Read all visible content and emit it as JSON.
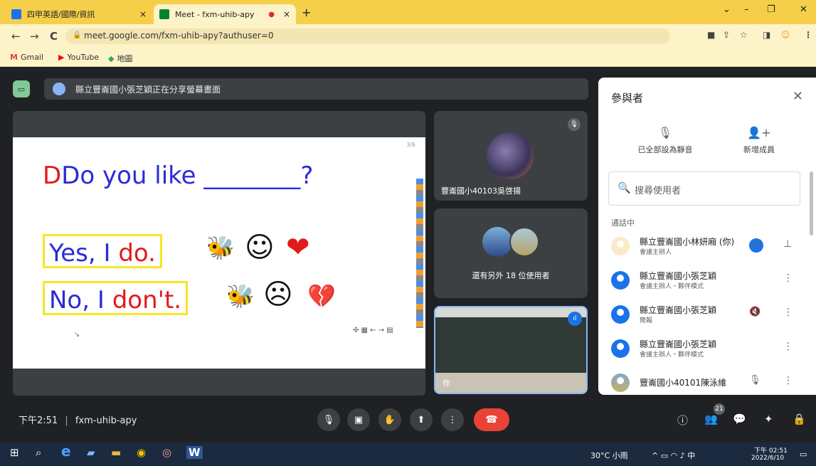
{
  "browser": {
    "tabs": [
      {
        "title": "四甲英語/國際/資訊",
        "favicon_color": "#1a73e8",
        "active": false
      },
      {
        "title": "Meet - fxm-uhib-apy",
        "favicon_color": "#00832d",
        "active": true
      }
    ],
    "close_glyph": "×",
    "record_glyph": "●",
    "newtab_glyph": "+",
    "window_controls": {
      "minimize": "–",
      "restore": "❐",
      "close": "✕",
      "dropdown": "⌄"
    },
    "nav": {
      "back": "←",
      "forward": "→",
      "reload": "C"
    },
    "url": "meet.google.com/fxm-uhib-apy?authuser=0",
    "lock_glyph": "🔒",
    "toolbar_icons": {
      "camera": "■",
      "share": "⇪",
      "star": "☆",
      "panel": "◨",
      "profile": "☺",
      "menu": "⋮"
    },
    "bookmarks": [
      {
        "label": "Gmail",
        "icon": "M",
        "icon_color": "#ea4335"
      },
      {
        "label": "YouTube",
        "icon": "▶",
        "icon_color": "#ff0000"
      },
      {
        "label": "地圖",
        "icon": "◆",
        "icon_color": "#34a853"
      }
    ]
  },
  "meet": {
    "share_icon": "▭",
    "share_banner": "縣立豐崙國小張芝穎正在分享螢幕畫面",
    "slide": {
      "question_prefix": "Do you like ",
      "question_blank": "________?",
      "yes_prefix": "Yes, I ",
      "yes_red": "do.",
      "no_prefix": "No, I ",
      "no_red": "don't.",
      "page_indicator": "3/6",
      "yes_emojis": "🐝 ☺ ❤",
      "no_emojis": "🐝 ☹ 💔",
      "yes_face": "☺",
      "no_face": "☹",
      "heart": "❤",
      "broken_heart": "💔",
      "bee": "🐝",
      "nav_widget": "✣ ▦ ← → ▤",
      "cursor": "↘"
    },
    "tiles": [
      {
        "name": "豐崙國小40103吳啓揚",
        "muted_icon": "🎙"
      },
      {
        "name": "還有另外 18 位使用者"
      },
      {
        "name": "你"
      }
    ]
  },
  "panel": {
    "title": "參與者",
    "close": "✕",
    "actions": [
      {
        "label": "已全部設為靜音",
        "icon": "🎙"
      },
      {
        "label": "新增成員",
        "icon": "👤+"
      }
    ],
    "search_icon": "🔍",
    "search_placeholder": "搜尋使用者",
    "section_label": "通話中",
    "participants": [
      {
        "name": "縣立豐崙國小林妍廂 (你)",
        "role": "會議主辦人",
        "icon1": "●",
        "icon2": "⊥"
      },
      {
        "name": "縣立豐崙國小張芝穎",
        "role": "會議主辦人・夥伴模式",
        "icon1": "",
        "icon2": "⋮"
      },
      {
        "name": "縣立豐崙國小張芝穎",
        "role": "簡報",
        "icon1": "🔇",
        "icon2": "⋮"
      },
      {
        "name": "縣立豐崙國小張芝穎",
        "role": "會議主辦人・夥伴模式",
        "icon1": "",
        "icon2": "⋮"
      },
      {
        "name": "豐崙國小40101陳泳維",
        "role": "",
        "icon1": "🎙",
        "icon2": "⋮"
      }
    ]
  },
  "bottom": {
    "time": "下午2:51",
    "separator": "|",
    "meeting_code": "fxm-uhib-apy",
    "controls": {
      "mic": "🎙",
      "camera": "▣",
      "hand": "✋",
      "present": "⬆",
      "more": "⋮",
      "leave": "☎"
    },
    "right_icons": {
      "info": "ⓘ",
      "people": "👥",
      "chat": "💬",
      "activities": "✦",
      "lock": "🔒"
    },
    "people_count": "21"
  },
  "taskbar": {
    "icons": {
      "start": "⊞",
      "search": "⌕",
      "ie": "e",
      "folder1": "▰",
      "folder2": "▬",
      "chrome": "◉",
      "chrome2": "◎",
      "word": "W"
    },
    "weather": "30°C 小雨",
    "tray_icons": "^ ▭ ◠ ♪ 中",
    "time": "下午 02:51",
    "date": "2022/6/10",
    "notification": "▭"
  }
}
